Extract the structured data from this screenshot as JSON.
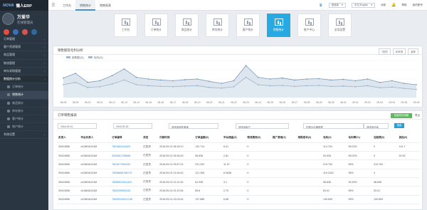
{
  "app": {
    "logo_text": "NOVA",
    "name": "懒人ERP"
  },
  "user": {
    "name": "万爱华",
    "role": "在线管理员"
  },
  "flags": [
    "#e74c3c",
    "#3b6fb6",
    "#d9534f",
    "#2c6aa0"
  ],
  "nav": [
    {
      "label": "订单管理",
      "type": "item"
    },
    {
      "label": "客户资源管理",
      "type": "item"
    },
    {
      "label": "商品管理",
      "type": "item"
    },
    {
      "label": "物流管理",
      "type": "item"
    },
    {
      "label": "库存采购管理",
      "type": "item"
    },
    {
      "label": "数据统计分析",
      "type": "item",
      "active": true
    },
    {
      "label": "订单统计",
      "type": "sub"
    },
    {
      "label": "销售统计",
      "type": "sub",
      "on": true
    },
    {
      "label": "商品统计",
      "type": "sub"
    },
    {
      "label": "库存统计",
      "type": "sub"
    },
    {
      "label": "客户统计",
      "type": "sub"
    },
    {
      "label": "账户统计",
      "type": "sub"
    },
    {
      "label": "系统设置",
      "type": "item"
    }
  ],
  "topbar": {
    "tabs": [
      "工作台",
      "销售统计",
      "销售报表"
    ],
    "active_tab": 1,
    "store_select": "请选择",
    "lang_select": "中文/English",
    "notify": "消息",
    "help": "帮助",
    "profile": "我的账号"
  },
  "icon_cards": [
    {
      "label": "工作台",
      "icon": "desk-icon"
    },
    {
      "label": "订单统计",
      "icon": "order-icon"
    },
    {
      "label": "商品统计",
      "icon": "goods-icon"
    },
    {
      "label": "库存统计",
      "icon": "stock-icon"
    },
    {
      "label": "客户统计",
      "icon": "customer-icon"
    },
    {
      "label": "销售统计",
      "icon": "sales-icon",
      "active": true
    },
    {
      "label": "账户中心",
      "icon": "account-icon"
    },
    {
      "label": "全局设置",
      "icon": "settings-icon"
    }
  ],
  "chart_panel": {
    "title": "销售额及毛利分析",
    "ranges": [
      "7天内",
      "30天内",
      "全年"
    ]
  },
  "chart_data": {
    "type": "area",
    "categories": [
      "08-08",
      "08-09",
      "08-10",
      "08-11",
      "08-12",
      "08-13",
      "08-14",
      "08-15",
      "08-16",
      "08-17",
      "08-18",
      "08-19",
      "08-20",
      "08-21",
      "08-22",
      "08-23",
      "08-24",
      "08-25",
      "08-26",
      "08-27",
      "08-28",
      "08-29",
      "08-30",
      "08-31",
      "09-01",
      "09-02",
      "09-03",
      "09-04",
      "09-05",
      "09-06"
    ],
    "series": [
      {
        "name": "销售额(元)",
        "values": [
          58,
          72,
          45,
          50,
          65,
          85,
          60,
          55,
          52,
          50,
          53,
          55,
          48,
          42,
          50,
          95,
          60,
          55,
          58,
          52,
          55,
          56,
          52,
          54,
          50,
          55,
          45,
          50,
          42,
          38
        ]
      },
      {
        "name": "毛利(元)",
        "values": [
          38,
          45,
          30,
          32,
          40,
          52,
          38,
          35,
          33,
          32,
          34,
          35,
          30,
          28,
          32,
          60,
          38,
          35,
          36,
          33,
          35,
          36,
          33,
          34,
          32,
          35,
          29,
          31,
          27,
          24
        ]
      }
    ],
    "ylim": [
      0,
      110
    ]
  },
  "report_panel": {
    "title": "订单销售报表",
    "export_btn": "批量导出明细",
    "print": "导出",
    "search_btn": "搜索"
  },
  "filters": [
    {
      "label": "2016-09-01"
    },
    {
      "label": "2016-09-30"
    },
    {
      "label": "请选择销售渠道"
    },
    {
      "label": "请选择客户"
    },
    {
      "label": "仅展示店铺数据"
    },
    {
      "label": "请选择仓库"
    }
  ],
  "table": {
    "columns": [
      "负责人",
      "平台负责人",
      "订单编号",
      "状态",
      "付款时间",
      "订单金额(¥)",
      "平台佣金(¥)",
      "物流费用(¥)",
      "推广费用(¥)",
      "采购成本(¥)",
      "毛利(¥)",
      "毛利率(%)",
      "包装费(¥)",
      "其他(¥)"
    ],
    "rows": [
      [
        "39424556",
        "x415818124M",
        "7801664161829",
        "已发货",
        "2016-09-01 06:18:12",
        "120.714",
        "6.01",
        "0",
        "",
        "",
        "114.704",
        "95.02%",
        "0",
        "114.7"
      ],
      [
        "39424556",
        "x415818124M",
        "3025961756666",
        "已发货",
        "2016-09-01 05:35:43",
        "56.836",
        "2.81",
        "0",
        "",
        "",
        "53.926",
        "95.02%",
        "0",
        "53.92"
      ],
      [
        "39424556",
        "x415818124M",
        "7801677054252",
        "已发货",
        "2016-09-01 05:57:24",
        "231.322",
        "11.57",
        "0",
        "",
        "",
        "219.752",
        "95%",
        "219.752",
        ""
      ],
      [
        "39424556",
        "x415818124M",
        "780586667581T0",
        "已发货",
        "2016-09-01 01:04:42",
        "121.306",
        "6.0638",
        "0",
        "",
        "",
        "115.2422",
        "95%",
        "0",
        ""
      ],
      [
        "39424556",
        "x415818124M",
        "78089621601420",
        "已发货",
        "2016-09-01 01:21:32",
        "61.936",
        "3.1",
        "0",
        "",
        "",
        "58.836",
        "94.99%",
        "58.836",
        ""
      ],
      [
        "39424556",
        "x415818124M",
        "7805299595193",
        "已发货",
        "2016-09-01 01:22:54",
        "55.8",
        "2.79",
        "0",
        "",
        "",
        "53.01",
        "95%",
        "53.01",
        ""
      ],
      [
        "39424556",
        "x415818124M",
        "7805094352/1138",
        "已发货",
        "2016-09-01 02:03:44",
        "137.686",
        "6.88",
        "0",
        "",
        "",
        "130.805",
        "95%",
        "130.805",
        ""
      ]
    ]
  }
}
